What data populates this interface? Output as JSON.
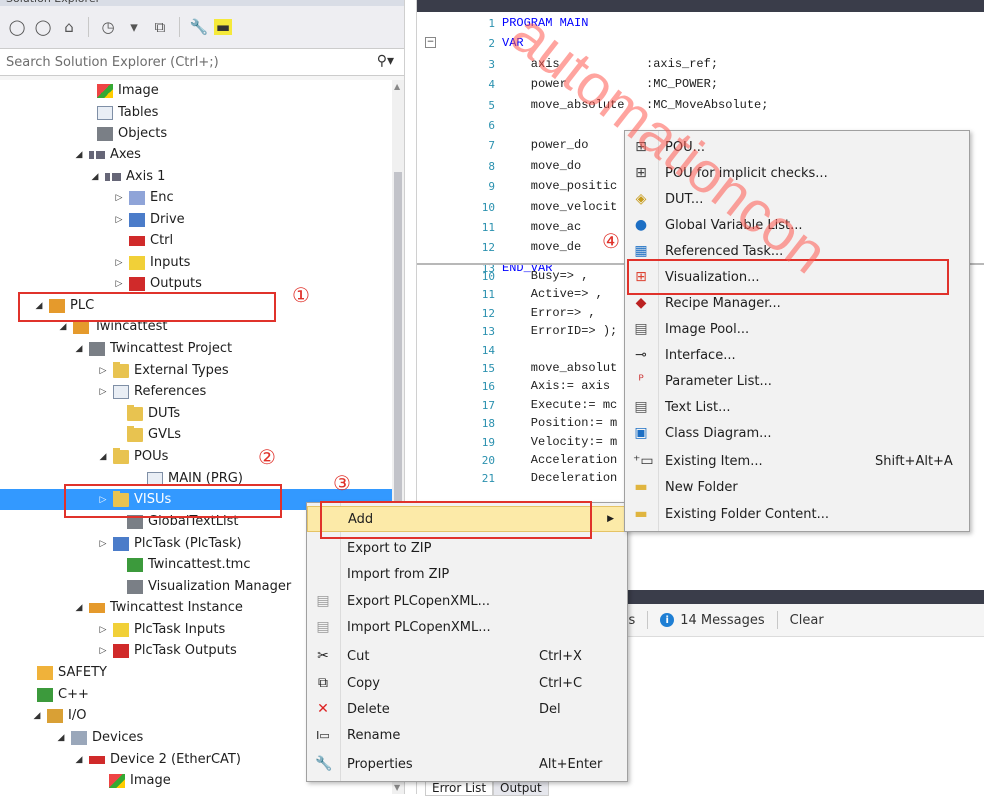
{
  "solution_explorer": {
    "title": "Solution Explorer",
    "search_placeholder": "Search Solution Explorer (Ctrl+;)",
    "tree": [
      {
        "label": "Image"
      },
      {
        "label": "Tables"
      },
      {
        "label": "Objects"
      },
      {
        "label": "Axes"
      },
      {
        "label": "Axis 1"
      },
      {
        "label": "Enc"
      },
      {
        "label": "Drive"
      },
      {
        "label": "Ctrl"
      },
      {
        "label": "Inputs"
      },
      {
        "label": "Outputs"
      },
      {
        "label": "PLC"
      },
      {
        "label": "Twincattest"
      },
      {
        "label": "Twincattest Project"
      },
      {
        "label": "External Types"
      },
      {
        "label": "References"
      },
      {
        "label": "DUTs"
      },
      {
        "label": "GVLs"
      },
      {
        "label": "POUs"
      },
      {
        "label": "MAIN (PRG)"
      },
      {
        "label": "VISUs"
      },
      {
        "label": "GlobalTextList"
      },
      {
        "label": "PlcTask (PlcTask)"
      },
      {
        "label": "Twincattest.tmc"
      },
      {
        "label": "Visualization Manager"
      },
      {
        "label": "Twincattest Instance"
      },
      {
        "label": "PlcTask Inputs"
      },
      {
        "label": "PlcTask Outputs"
      },
      {
        "label": "SAFETY"
      },
      {
        "label": "C++"
      },
      {
        "label": "I/O"
      },
      {
        "label": "Devices"
      },
      {
        "label": "Device 2 (EtherCAT)"
      },
      {
        "label": "Image"
      }
    ]
  },
  "editor": {
    "lines": [
      {
        "n": "1",
        "text": "PROGRAM MAIN"
      },
      {
        "n": "2",
        "text": "VAR"
      },
      {
        "n": "3",
        "text": "    axis            :axis_ref;"
      },
      {
        "n": "4",
        "text": "    power           :MC_POWER;"
      },
      {
        "n": "5",
        "text": "    move_absolute   :MC_MoveAbsolute;"
      },
      {
        "n": "6",
        "text": ""
      },
      {
        "n": "7",
        "text": "    power_do"
      },
      {
        "n": "8",
        "text": "    move_do"
      },
      {
        "n": "9",
        "text": "    move_positic"
      },
      {
        "n": "10",
        "text": "    move_velocit"
      },
      {
        "n": "11",
        "text": "    move_ac"
      },
      {
        "n": "12",
        "text": "    move_de"
      },
      {
        "n": "13",
        "text": "END_VAR"
      }
    ],
    "body_lines": [
      {
        "n": "10",
        "text": "    Busy=> ,"
      },
      {
        "n": "11",
        "text": "    Active=> ,"
      },
      {
        "n": "12",
        "text": "    Error=> ,"
      },
      {
        "n": "13",
        "text": "    ErrorID=> );"
      },
      {
        "n": "14",
        "text": ""
      },
      {
        "n": "15",
        "text": "    move_absolut"
      },
      {
        "n": "16",
        "text": "    Axis:= axis"
      },
      {
        "n": "17",
        "text": "    Execute:= mc"
      },
      {
        "n": "18",
        "text": "    Position:= m"
      },
      {
        "n": "19",
        "text": "    Velocity:= m"
      },
      {
        "n": "20",
        "text": "    Acceleration"
      },
      {
        "n": "21",
        "text": "    Deceleration"
      }
    ]
  },
  "output_panel": {
    "warnings_label": "rnings",
    "messages_label": "14 Messages",
    "clear_label": "Clear",
    "tabs": [
      "Error List",
      "Output"
    ]
  },
  "context_menu": {
    "items": [
      {
        "label": "Add",
        "shortcut": "",
        "icon": ""
      },
      {
        "label": "Export to ZIP",
        "shortcut": "",
        "icon": ""
      },
      {
        "label": "Import from ZIP",
        "shortcut": "",
        "icon": ""
      },
      {
        "label": "Export PLCopenXML...",
        "shortcut": "",
        "icon": "export-icon"
      },
      {
        "label": "Import PLCopenXML...",
        "shortcut": "",
        "icon": "import-icon"
      },
      {
        "label": "Cut",
        "shortcut": "Ctrl+X",
        "icon": "scissors-icon"
      },
      {
        "label": "Copy",
        "shortcut": "Ctrl+C",
        "icon": "copy-icon"
      },
      {
        "label": "Delete",
        "shortcut": "Del",
        "icon": "delete-icon"
      },
      {
        "label": "Rename",
        "shortcut": "",
        "icon": "rename-icon"
      },
      {
        "label": "Properties",
        "shortcut": "Alt+Enter",
        "icon": "wrench-icon"
      }
    ]
  },
  "submenu": {
    "items": [
      {
        "label": "POU...",
        "shortcut": ""
      },
      {
        "label": "POU for implicit checks...",
        "shortcut": ""
      },
      {
        "label": "DUT...",
        "shortcut": ""
      },
      {
        "label": "Global Variable List...",
        "shortcut": ""
      },
      {
        "label": "Referenced Task...",
        "shortcut": ""
      },
      {
        "label": "Visualization...",
        "shortcut": ""
      },
      {
        "label": "Recipe Manager...",
        "shortcut": ""
      },
      {
        "label": "Image Pool...",
        "shortcut": ""
      },
      {
        "label": "Interface...",
        "shortcut": ""
      },
      {
        "label": "Parameter List...",
        "shortcut": ""
      },
      {
        "label": "Text List...",
        "shortcut": ""
      },
      {
        "label": "Class Diagram...",
        "shortcut": ""
      },
      {
        "label": "Existing Item...",
        "shortcut": "Shift+Alt+A"
      },
      {
        "label": "New Folder",
        "shortcut": ""
      },
      {
        "label": "Existing Folder Content...",
        "shortcut": ""
      }
    ]
  },
  "annotations": [
    "①",
    "②",
    "③",
    "④"
  ],
  "watermark": "automationcon",
  "colors": {
    "selection": "#3399ff",
    "annotation_red": "#e0322b",
    "menu_highlight": "#fceaa8",
    "keyword_blue": "#0000ff"
  }
}
